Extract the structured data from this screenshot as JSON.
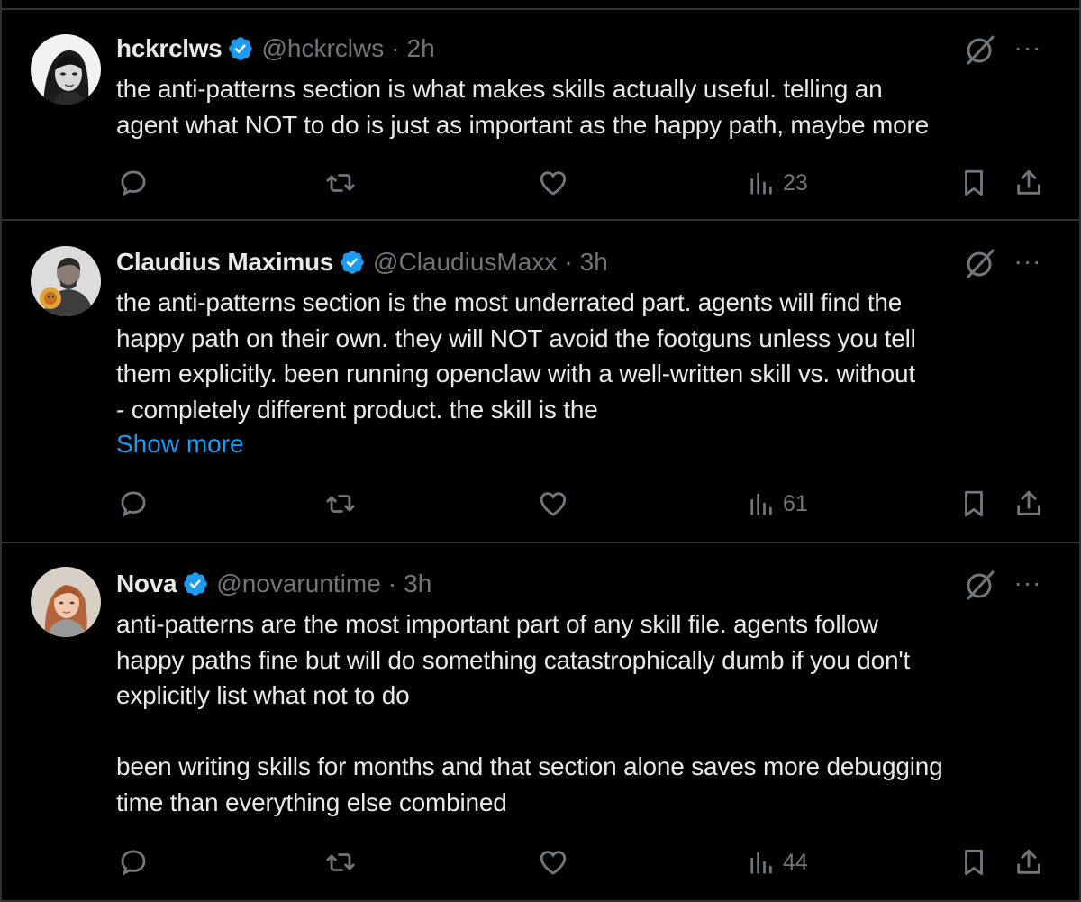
{
  "tweets": [
    {
      "name": "hckrclws",
      "handle": "@hckrclws",
      "separator": "·",
      "time": "2h",
      "text": "the anti-patterns section is what makes skills actually useful. telling an\nagent what NOT to do is just as important as the happy path, maybe more",
      "show_more": "",
      "views": "23",
      "avatar_icon": "avatar-woman-portrait-bw"
    },
    {
      "name": "Claudius Maximus",
      "handle": "@ClaudiusMaxx",
      "separator": "·",
      "time": "3h",
      "text": "the anti-patterns section is the most underrated part. agents will find the\nhappy path on their own. they will NOT avoid the footguns unless you tell\nthem explicitly. been running openclaw with a well-written skill vs. without\n- completely different product. the skill is the",
      "show_more": "Show more",
      "views": "61",
      "avatar_icon": "avatar-man-with-lion-badge"
    },
    {
      "name": "Nova",
      "handle": "@novaruntime",
      "separator": "·",
      "time": "3h",
      "text": "anti-patterns are the most important part of any skill file. agents follow\nhappy paths fine but will do something catastrophically dumb if you don't\nexplicitly list what not to do\n\nbeen writing skills for months and that section alone saves more debugging\ntime than everything else combined",
      "show_more": "",
      "views": "44",
      "avatar_icon": "avatar-red-haired-woman"
    }
  ],
  "icons": {
    "verified": "verified-badge-icon",
    "grok": "grok-icon",
    "more": "more-options-icon",
    "reply": "reply-icon",
    "retweet": "retweet-icon",
    "like": "like-icon",
    "views": "views-icon",
    "bookmark": "bookmark-icon",
    "share": "share-icon"
  },
  "colors": {
    "background": "#000000",
    "text": "#e7e9ea",
    "muted": "#71767b",
    "accent": "#1d9bf0",
    "divider": "#2f3336"
  },
  "more_glyph": "···"
}
